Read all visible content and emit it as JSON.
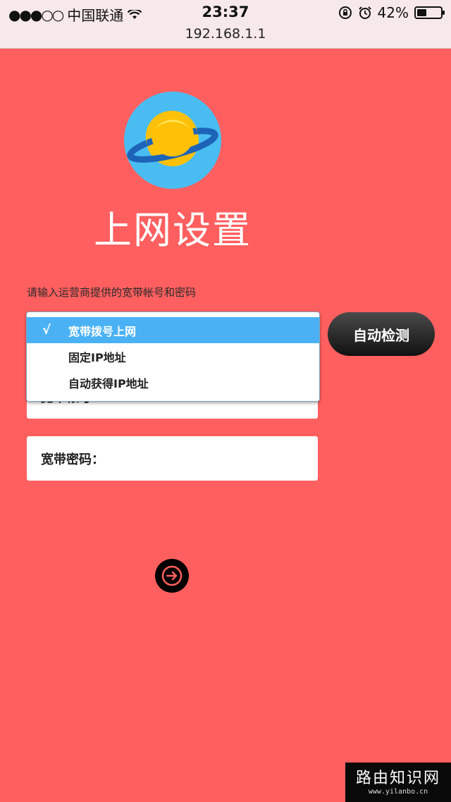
{
  "status_bar": {
    "signal": "●●●○○",
    "carrier": "中国联通",
    "time": "23:37",
    "battery_text": "42%",
    "battery_level": 0.42
  },
  "browser": {
    "url": "192.168.1.1"
  },
  "page": {
    "title": "上网设置",
    "instruction": "请输入运营商提供的宽带帐号和密码",
    "auto_detect_label": "自动检测",
    "account_label": "宽带帐号",
    "password_label": "宽带密码："
  },
  "dropdown": {
    "check_mark": "√",
    "options": [
      {
        "label": "宽带拨号上网",
        "selected": true
      },
      {
        "label": "固定IP地址",
        "selected": false
      },
      {
        "label": "自动获得IP地址",
        "selected": false
      }
    ]
  },
  "watermark": {
    "title": "路由知识网",
    "url": "www.yilanbo.cn"
  },
  "colors": {
    "background": "#ff5f5f",
    "selected": "#4ab2f4",
    "logo": "#49bdf2",
    "planet": "#ffc107",
    "ring": "#1d63b8"
  }
}
